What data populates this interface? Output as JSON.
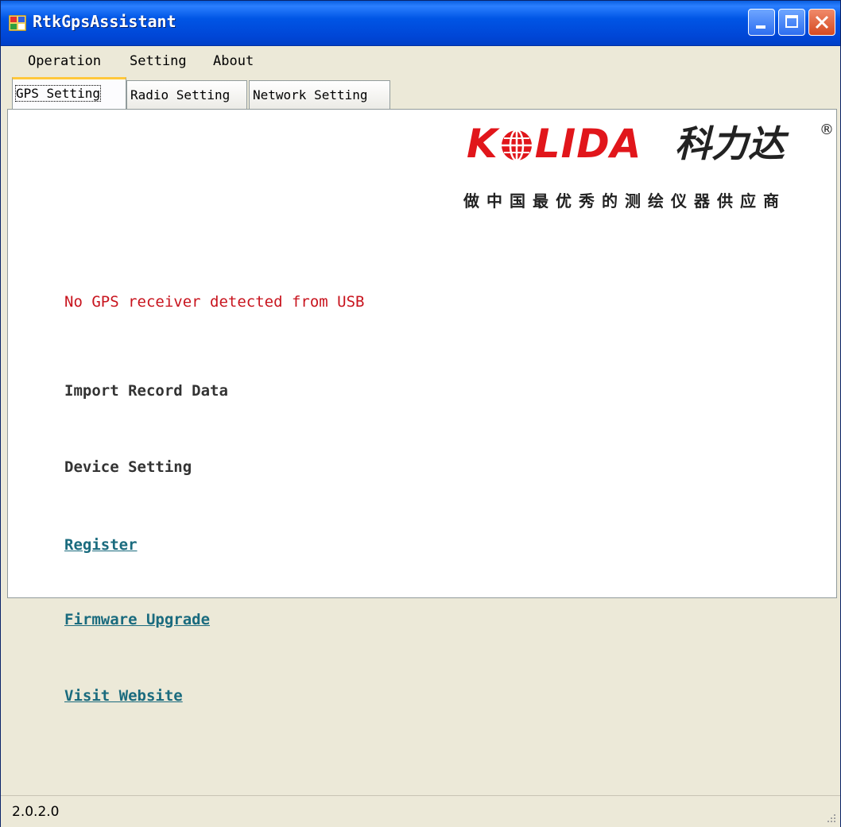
{
  "window": {
    "title": "RtkGpsAssistant"
  },
  "menu": {
    "operation": "Operation",
    "setting": "Setting",
    "about": "About"
  },
  "tabs": [
    {
      "label": "GPS Setting",
      "active": true
    },
    {
      "label": "Radio Setting",
      "active": false
    },
    {
      "label": "Network Setting",
      "active": false
    }
  ],
  "logo": {
    "brand_left": "K",
    "brand_right": "LIDA",
    "brand_cn": "科力达",
    "registered": "®",
    "slogan": "做中国最优秀的测绘仪器供应商",
    "brand_color": "#e1161b"
  },
  "content": {
    "status_message": "No GPS receiver detected from USB",
    "import_record_data": "Import Record Data",
    "device_setting": "Device Setting",
    "register": "Register",
    "firmware_upgrade": "Firmware Upgrade",
    "visit_website": "Visit Website"
  },
  "statusbar": {
    "version": "2.0.2.0"
  },
  "colors": {
    "titlebar": "#0055e5",
    "status_error": "#c8141e",
    "link": "#1a6b7e",
    "active_tab_accent": "#ffc83c"
  }
}
